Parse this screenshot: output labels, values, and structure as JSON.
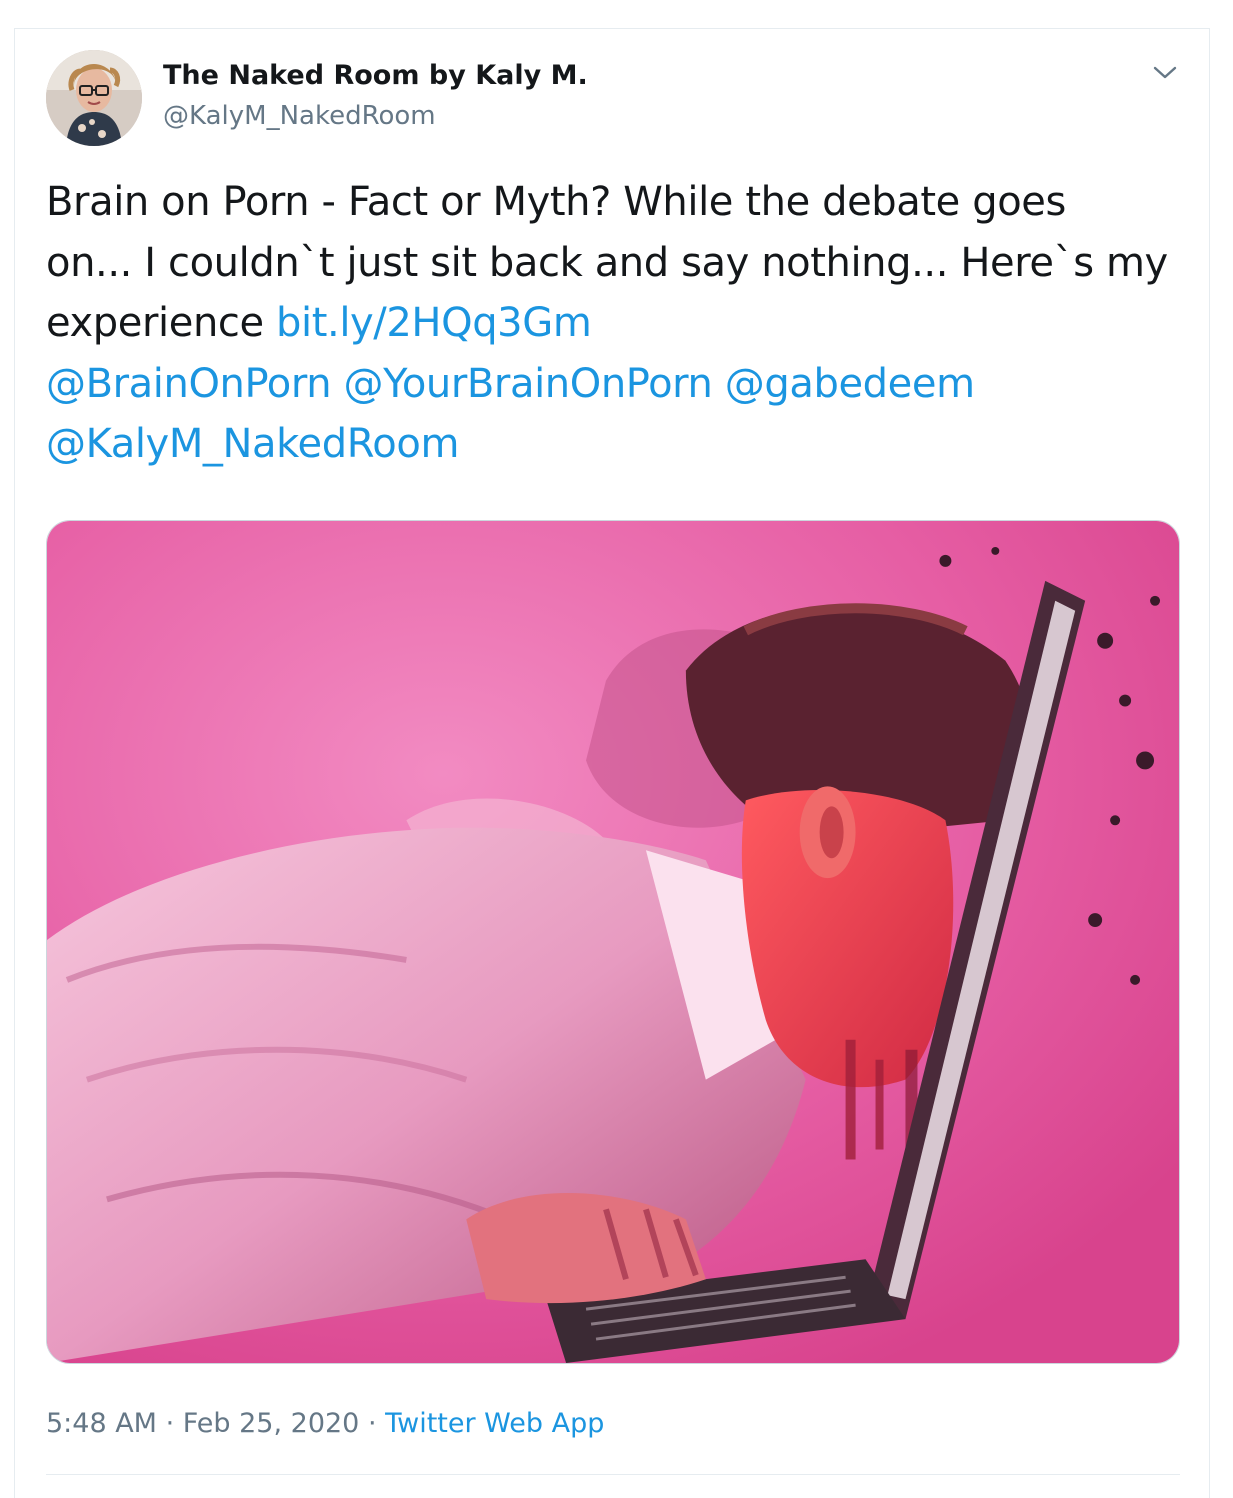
{
  "tweet": {
    "display_name": "The Naked Room by Kaly M.",
    "handle": "@KalyM_NakedRoom",
    "text_lines": [
      "Brain on Porn - Fact or Myth? While the debate goes",
      "on... I couldn`t just sit back and say nothing... Here`s my",
      "experience "
    ],
    "link": "bit.ly/2HQq3Gm",
    "mentions": [
      "@BrainOnPorn",
      "@YourBrainOnPorn",
      "@gabedeem",
      "@KalyM_NakedRoom"
    ],
    "time": "5:48 AM",
    "separator": " · ",
    "date": "Feb 25, 2020",
    "source": "Twitter Web App"
  },
  "icons": {
    "menu": "chevron-down-icon"
  },
  "colors": {
    "link": "#1b95e0",
    "secondary_text": "#657786",
    "primary_text": "#14171a",
    "media_background": "#e8509b"
  }
}
